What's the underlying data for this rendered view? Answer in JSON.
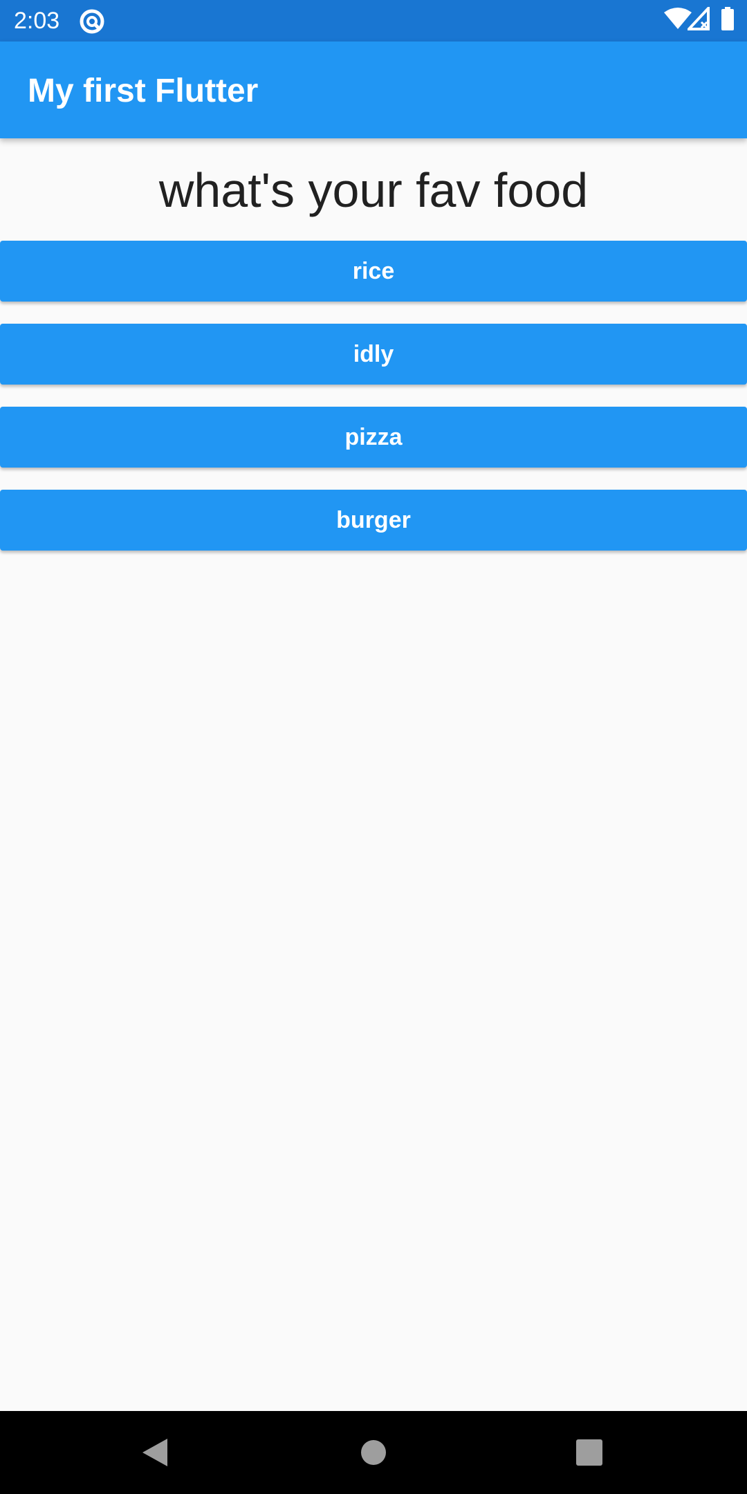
{
  "status_bar": {
    "time": "2:03",
    "icons": [
      "sync-icon",
      "wifi-icon",
      "signal-icon",
      "battery-icon"
    ]
  },
  "app_bar": {
    "title": "My first Flutter",
    "color": "#2196f3"
  },
  "main": {
    "question": "what's your fav food",
    "buttons": [
      {
        "label": "rice"
      },
      {
        "label": "idly"
      },
      {
        "label": "pizza"
      },
      {
        "label": "burger"
      }
    ]
  },
  "nav_bar": {
    "icons": [
      "back-icon",
      "home-icon",
      "recents-icon"
    ]
  },
  "colors": {
    "primary": "#2196f3",
    "status_bar": "#1976d2",
    "background": "#fafafa",
    "nav_bar": "#000000"
  }
}
